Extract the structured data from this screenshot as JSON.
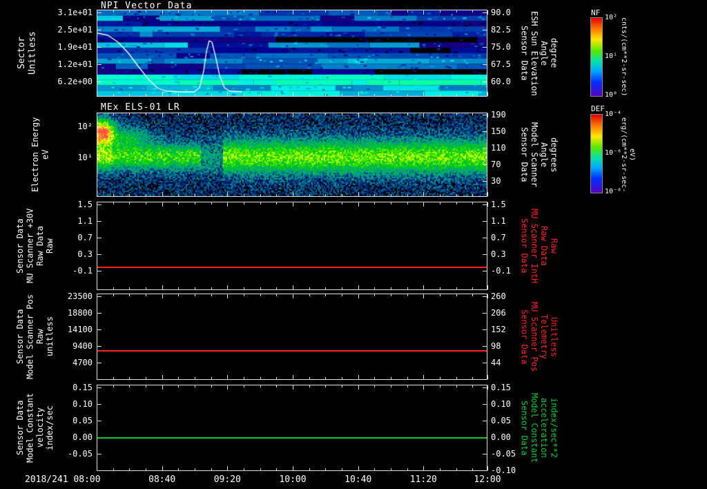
{
  "window": {
    "background": "#000000"
  },
  "panels": [
    {
      "id": "npi",
      "title": "NPI Vector Data",
      "left_label": "Sector\nUnitless",
      "left_ticks": [
        "3.1e+01",
        "2.5e+01",
        "1.9e+01",
        "1.2e+01",
        "6.2e+00"
      ],
      "right_label": "Sensor Data\nESH Sun Elevation\nAngle\ndegree",
      "right_ticks": [
        "90.0",
        "82.5",
        "75.0",
        "67.5",
        "60.0"
      ]
    },
    {
      "id": "els",
      "title": "MEx ELS-01 LR",
      "left_label": "Electron Energy\neV",
      "left_ticks": [
        "10²",
        "10¹"
      ],
      "right_label": "Sensor Data\nModel Scanner\nAngle\ndegrees",
      "right_ticks": [
        "190",
        "150",
        "110",
        "70",
        "30"
      ]
    },
    {
      "id": "mu30v",
      "left_label": "Sensor Data\nMU Scanner +30V\nRaw Data\nRaw",
      "left_ticks": [
        "1.5",
        "1.1",
        "0.7",
        "0.3",
        "-0.1"
      ],
      "right_label": "Sensor Data\nMU Scanner IntH\nRaw Data\nRaw",
      "right_label_color": "#ff2222",
      "right_ticks": [
        "1.5",
        "1.1",
        "0.7",
        "0.3",
        "-0.1"
      ],
      "line": {
        "value": 0.0,
        "color": "#ff2222"
      }
    },
    {
      "id": "scannerpos",
      "left_label": "Sensor Data\nModel Scanner Pos\nRaw\nunitless",
      "left_ticks": [
        "23500",
        "18800",
        "14100",
        "9400",
        "4700"
      ],
      "right_label": "Sensor Data\nMU Scanner Pos\nTelemetry\nUnitless",
      "right_label_color": "#ff2222",
      "right_ticks": [
        "260",
        "206",
        "152",
        "98",
        "44"
      ],
      "line": {
        "value": 8300,
        "color": "#ff2222"
      }
    },
    {
      "id": "modelconst",
      "left_label": "Sensor Data\nModel Constant\nvelocity\nindex/sec",
      "left_ticks": [
        "0.15",
        "0.10",
        "0.05",
        "0.00",
        "-0.05"
      ],
      "right_label": "Sensor Data\nModel Constant\nacceleration\nindex/sec**2",
      "right_label_color": "#00cc33",
      "right_ticks": [
        "0.15",
        "0.10",
        "0.05",
        "0.00",
        "-0.05",
        "-0.10"
      ],
      "line": {
        "value": 0.0,
        "color": "#00cc33"
      }
    }
  ],
  "colorbars": [
    {
      "id": "nf",
      "title": "NF",
      "unit": "cnts/(cm**2-sr-sec)",
      "ticks": [
        "10²",
        "10¹",
        "10⁰"
      ]
    },
    {
      "id": "def",
      "title": "DEF",
      "unit": "erg/(cm**2-sr-sec-eV)",
      "ticks": [
        "10⁻⁴",
        "10⁻⁶",
        "10⁻⁸"
      ]
    }
  ],
  "x_axis": {
    "ticks": [
      "2018/241 08:00",
      "08:40",
      "09:20",
      "10:00",
      "10:40",
      "11:20",
      "12:00"
    ]
  },
  "chart_data": [
    {
      "type": "heatmap",
      "title": "NPI Vector Data",
      "xlabel": "Time 2018/241 08:00 - 12:00",
      "ylabel": "Sector Unitless",
      "y_ticks": [
        "3.1e+01",
        "2.5e+01",
        "1.9e+01",
        "1.2e+01",
        "6.2e+00"
      ],
      "right_axis": {
        "label": "Sensor Data ESH Sun Elevation Angle degree",
        "ticks": [
          90.0,
          82.5,
          75.0,
          67.5,
          60.0
        ]
      },
      "colorbar": {
        "label": "NF",
        "unit": "cnts/(cm**2-sr-sec)",
        "tick_range": [
          "10⁰",
          "10²"
        ]
      },
      "content": "Horizontal sector bands of blue/purple/cyan count rates; brightest cyan bands in the lowest sectors; several dark (no-count) sector rows; block-segmented structure in time",
      "overlay_line": {
        "name": "ESH Sun Elevation Angle",
        "units": "degree",
        "x_times": [
          "08:00",
          "08:08",
          "08:20",
          "08:32",
          "08:40",
          "08:55",
          "09:05",
          "09:08",
          "09:12",
          "09:20",
          "09:30"
        ],
        "y_values": [
          80,
          76,
          68,
          62,
          60.5,
          60.5,
          70,
          78,
          64,
          60.5,
          60.5
        ]
      }
    },
    {
      "type": "heatmap",
      "title": "MEx ELS-01 LR",
      "ylabel": "Electron Energy eV",
      "y_scale": "log",
      "y_ticks": [
        "10²",
        "10¹"
      ],
      "right_axis": {
        "label": "Sensor Data Model Scanner Angle degrees",
        "ticks": [
          190,
          150,
          110,
          70,
          30
        ]
      },
      "colorbar": {
        "label": "DEF",
        "unit": "erg/(cm**2-sr-sec-eV)"
      },
      "content": "Continuous green flux band near 10-20 eV across the whole interval over a blue noisy background; intense red-orange enhancement at 30-100 eV around 08:00-08:10; brief dropout of the band near 09:05-09:15"
    },
    {
      "type": "line",
      "name": "Sensor Data MU Scanner +30V Raw Data Raw / MU Scanner IntH Raw Data Raw",
      "color": "#ff2222",
      "y_ticks": [
        1.5,
        1.1,
        0.7,
        0.3,
        -0.1
      ],
      "constant_value": 0.0,
      "x_range": [
        "08:00",
        "12:00"
      ]
    },
    {
      "type": "line",
      "name": "Sensor Data Model Scanner Pos Raw unitless / MU Scanner Pos Telemetry Unitless",
      "color": "#ff2222",
      "y_ticks": [
        23500,
        18800,
        14100,
        9400,
        4700
      ],
      "right_y_ticks": [
        260,
        206,
        152,
        98,
        44
      ],
      "constant_value": 8300,
      "x_range": [
        "08:00",
        "12:00"
      ]
    },
    {
      "type": "line",
      "name": "Sensor Data Model Constant velocity index/sec / acceleration index/sec**2",
      "color": "#00cc33",
      "y_ticks": [
        0.15,
        0.1,
        0.05,
        0.0,
        -0.05
      ],
      "right_y_ticks": [
        0.15,
        0.1,
        0.05,
        0.0,
        -0.05,
        -0.1
      ],
      "constant_value": 0.0,
      "x_range": [
        "08:00",
        "12:00"
      ]
    }
  ]
}
